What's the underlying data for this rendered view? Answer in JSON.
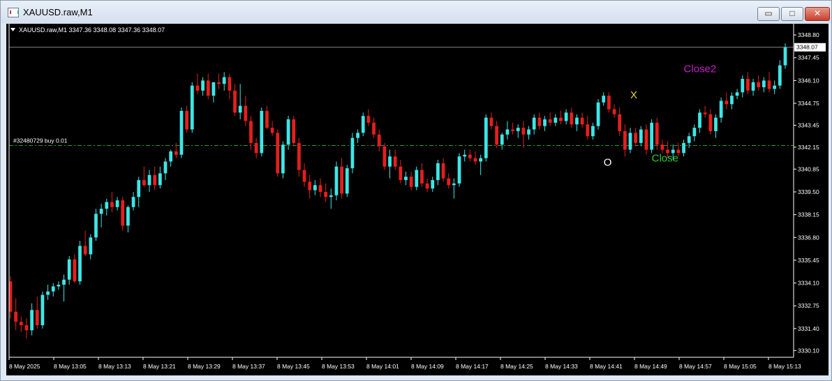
{
  "window": {
    "title": "XAUUSD.raw,M1",
    "buttons": {
      "minimize": "▭",
      "restore": "□",
      "close": "✕"
    }
  },
  "colors": {
    "bull": "#3ee6e6",
    "bear": "#e61e1e",
    "background": "#000000",
    "foreground": "#ffffff",
    "order_line": "#28a028"
  },
  "chart_data": {
    "type": "candlestick",
    "symbol_header": "XAUUSD.raw,M1  3347.36 3348.08 3347.36 3348.07",
    "ylim": [
      3329.7,
      3349.3
    ],
    "y_ticks": [
      "3348.80",
      "3347.45",
      "3346.10",
      "3344.75",
      "3343.45",
      "3342.15",
      "3340.85",
      "3339.50",
      "3338.15",
      "3336.80",
      "3335.45",
      "3334.10",
      "3332.75",
      "3331.40",
      "3330.10"
    ],
    "x_ticks": [
      "8 May 2025",
      "8 May 13:05",
      "8 May 13:13",
      "8 May 13:21",
      "8 May 13:29",
      "8 May 13:37",
      "8 May 13:45",
      "8 May 13:53",
      "8 May 14:01",
      "8 May 14:09",
      "8 May 14:17",
      "8 May 14:25",
      "8 May 14:33",
      "8 May 14:41",
      "8 May 14:49",
      "8 May 14:57",
      "8 May 15:05",
      "8 May 15:13"
    ],
    "current_price": "3348.07",
    "order_line": {
      "label": "#32480729 buy 0.01",
      "price": 3342.25
    },
    "annotations": [
      {
        "text": "O",
        "bar": 111,
        "price": 3341.05,
        "color": "#ffffff"
      },
      {
        "text": "X",
        "bar": 116,
        "price": 3345.05,
        "color": "#e6d23c"
      },
      {
        "text": "Close",
        "bar": 120,
        "price": 3341.3,
        "color": "#32c832"
      },
      {
        "text": "Close2",
        "bar": 126,
        "price": "3346.6",
        "color": "#c81ec8"
      }
    ],
    "candles": [
      [
        3334.2,
        3334.5,
        3332.0,
        3332.4
      ],
      [
        3332.4,
        3333.2,
        3331.3,
        3331.8
      ],
      [
        3331.8,
        3332.1,
        3331.2,
        3331.6
      ],
      [
        3331.6,
        3332.0,
        3330.8,
        3331.3
      ],
      [
        3331.3,
        3332.9,
        3331.0,
        3332.5
      ],
      [
        3332.5,
        3333.3,
        3331.4,
        3331.6
      ],
      [
        3331.6,
        3333.6,
        3331.4,
        3333.4
      ],
      [
        3333.4,
        3334.0,
        3333.1,
        3333.6
      ],
      [
        3333.6,
        3334.1,
        3333.3,
        3333.9
      ],
      [
        3333.9,
        3334.2,
        3333.7,
        3334.0
      ],
      [
        3334.0,
        3334.6,
        3333.0,
        3334.3
      ],
      [
        3334.3,
        3335.7,
        3334.0,
        3335.5
      ],
      [
        3335.5,
        3335.8,
        3334.1,
        3334.2
      ],
      [
        3334.2,
        3336.6,
        3334.0,
        3336.3
      ],
      [
        3336.3,
        3337.2,
        3335.7,
        3335.8
      ],
      [
        3335.8,
        3337.0,
        3335.5,
        3336.8
      ],
      [
        3336.8,
        3338.5,
        3336.6,
        3338.2
      ],
      [
        3338.2,
        3338.8,
        3337.4,
        3338.5
      ],
      [
        3338.5,
        3339.1,
        3338.1,
        3338.9
      ],
      [
        3338.9,
        3339.5,
        3338.3,
        3338.6
      ],
      [
        3338.6,
        3339.2,
        3338.4,
        3339.0
      ],
      [
        3339.0,
        3339.2,
        3337.2,
        3337.5
      ],
      [
        3337.5,
        3338.7,
        3337.1,
        3338.6
      ],
      [
        3338.6,
        3339.5,
        3338.4,
        3339.2
      ],
      [
        3339.2,
        3340.4,
        3338.6,
        3340.2
      ],
      [
        3340.2,
        3341.0,
        3339.8,
        3339.9
      ],
      [
        3339.9,
        3340.8,
        3339.5,
        3340.5
      ],
      [
        3340.5,
        3341.0,
        3339.6,
        3339.9
      ],
      [
        3339.9,
        3341.0,
        3339.7,
        3340.6
      ],
      [
        3340.6,
        3341.5,
        3340.2,
        3341.3
      ],
      [
        3341.3,
        3342.0,
        3341.0,
        3341.9
      ],
      [
        3341.9,
        3342.4,
        3341.5,
        3341.7
      ],
      [
        3341.7,
        3344.5,
        3341.5,
        3344.3
      ],
      [
        3344.3,
        3344.6,
        3343.0,
        3343.2
      ],
      [
        3343.2,
        3346.0,
        3343.0,
        3345.8
      ],
      [
        3345.8,
        3346.5,
        3345.3,
        3345.5
      ],
      [
        3345.5,
        3346.3,
        3345.2,
        3346.1
      ],
      [
        3346.1,
        3346.5,
        3345.0,
        3345.2
      ],
      [
        3345.2,
        3346.0,
        3344.8,
        3346.0
      ],
      [
        3346.0,
        3346.5,
        3345.6,
        3345.9
      ],
      [
        3345.9,
        3346.6,
        3345.5,
        3346.3
      ],
      [
        3346.3,
        3346.5,
        3345.0,
        3345.5
      ],
      [
        3345.5,
        3345.9,
        3344.0,
        3344.2
      ],
      [
        3344.2,
        3345.9,
        3343.8,
        3344.6
      ],
      [
        3344.6,
        3345.2,
        3343.4,
        3343.7
      ],
      [
        3343.7,
        3344.0,
        3342.0,
        3342.4
      ],
      [
        3342.4,
        3342.7,
        3341.5,
        3341.8
      ],
      [
        3341.8,
        3344.5,
        3341.6,
        3344.3
      ],
      [
        3344.3,
        3344.6,
        3343.2,
        3343.3
      ],
      [
        3343.3,
        3343.7,
        3342.8,
        3343.0
      ],
      [
        3343.0,
        3343.2,
        3340.4,
        3340.6
      ],
      [
        3340.6,
        3342.5,
        3340.3,
        3342.3
      ],
      [
        3342.3,
        3344.0,
        3342.0,
        3343.8
      ],
      [
        3343.8,
        3344.0,
        3342.2,
        3342.4
      ],
      [
        3342.4,
        3342.7,
        3340.4,
        3340.8
      ],
      [
        3340.8,
        3341.2,
        3339.8,
        3340.1
      ],
      [
        3340.1,
        3340.5,
        3339.1,
        3339.6
      ],
      [
        3339.6,
        3340.2,
        3339.3,
        3339.9
      ],
      [
        3339.9,
        3340.3,
        3339.2,
        3339.5
      ],
      [
        3339.5,
        3340.0,
        3338.9,
        3339.2
      ],
      [
        3339.2,
        3339.7,
        3338.5,
        3339.3
      ],
      [
        3339.3,
        3341.3,
        3339.0,
        3341.0
      ],
      [
        3341.0,
        3341.5,
        3339.1,
        3339.4
      ],
      [
        3339.4,
        3341.1,
        3339.2,
        3340.9
      ],
      [
        3340.9,
        3343.0,
        3340.6,
        3342.7
      ],
      [
        3342.7,
        3343.2,
        3342.4,
        3343.0
      ],
      [
        3343.0,
        3344.2,
        3342.8,
        3344.0
      ],
      [
        3344.0,
        3344.4,
        3343.4,
        3343.6
      ],
      [
        3343.6,
        3343.9,
        3342.7,
        3342.9
      ],
      [
        3342.9,
        3343.2,
        3341.9,
        3342.2
      ],
      [
        3342.2,
        3342.4,
        3340.8,
        3341.0
      ],
      [
        3341.0,
        3342.0,
        3340.3,
        3341.6
      ],
      [
        3341.6,
        3342.0,
        3340.8,
        3341.0
      ],
      [
        3341.0,
        3341.4,
        3340.0,
        3340.2
      ],
      [
        3340.2,
        3340.7,
        3339.9,
        3340.4
      ],
      [
        3340.4,
        3340.7,
        3339.6,
        3339.8
      ],
      [
        3339.8,
        3341.0,
        3339.6,
        3340.8
      ],
      [
        3340.8,
        3341.2,
        3339.8,
        3340.0
      ],
      [
        3340.0,
        3340.3,
        3339.5,
        3339.7
      ],
      [
        3339.7,
        3340.4,
        3339.5,
        3340.2
      ],
      [
        3340.2,
        3341.4,
        3339.9,
        3341.2
      ],
      [
        3341.2,
        3341.5,
        3340.1,
        3340.3
      ],
      [
        3340.3,
        3340.6,
        3339.7,
        3339.9
      ],
      [
        3339.9,
        3340.3,
        3339.1,
        3340.0
      ],
      [
        3340.0,
        3341.8,
        3339.8,
        3341.6
      ],
      [
        3341.6,
        3342.0,
        3341.3,
        3341.7
      ],
      [
        3341.7,
        3342.0,
        3341.3,
        3341.5
      ],
      [
        3341.5,
        3341.9,
        3341.1,
        3341.3
      ],
      [
        3341.3,
        3341.7,
        3340.5,
        3341.5
      ],
      [
        3341.5,
        3344.1,
        3341.3,
        3343.9
      ],
      [
        3343.9,
        3344.2,
        3343.2,
        3343.4
      ],
      [
        3343.4,
        3343.7,
        3342.1,
        3342.3
      ],
      [
        3342.3,
        3343.0,
        3342.0,
        3342.9
      ],
      [
        3342.9,
        3343.7,
        3342.6,
        3343.2
      ],
      [
        3343.2,
        3343.6,
        3342.9,
        3343.1
      ],
      [
        3343.1,
        3343.5,
        3342.7,
        3343.3
      ],
      [
        3343.3,
        3343.7,
        3342.1,
        3342.9
      ],
      [
        3342.9,
        3343.4,
        3342.6,
        3343.2
      ],
      [
        3343.2,
        3344.1,
        3342.9,
        3343.9
      ],
      [
        3343.9,
        3344.2,
        3343.2,
        3343.4
      ],
      [
        3343.4,
        3344.0,
        3343.1,
        3343.8
      ],
      [
        3343.8,
        3344.2,
        3343.4,
        3343.6
      ],
      [
        3343.6,
        3344.1,
        3343.4,
        3343.9
      ],
      [
        3343.9,
        3344.3,
        3343.5,
        3343.7
      ],
      [
        3343.7,
        3344.4,
        3343.5,
        3344.2
      ],
      [
        3344.2,
        3344.5,
        3343.3,
        3343.5
      ],
      [
        3343.5,
        3344.1,
        3343.1,
        3343.9
      ],
      [
        3343.9,
        3344.2,
        3343.3,
        3343.5
      ],
      [
        3343.5,
        3344.0,
        3342.6,
        3342.8
      ],
      [
        3342.8,
        3343.6,
        3342.6,
        3343.4
      ],
      [
        3343.4,
        3345.0,
        3343.2,
        3344.8
      ],
      [
        3344.8,
        3345.4,
        3344.6,
        3345.2
      ],
      [
        3345.2,
        3345.4,
        3344.2,
        3344.4
      ],
      [
        3344.4,
        3344.7,
        3343.9,
        3344.1
      ],
      [
        3344.1,
        3344.5,
        3342.8,
        3343.1
      ],
      [
        3343.1,
        3343.5,
        3341.6,
        3342.0
      ],
      [
        3342.0,
        3343.3,
        3341.8,
        3343.0
      ],
      [
        3343.0,
        3343.3,
        3342.2,
        3342.4
      ],
      [
        3342.4,
        3343.4,
        3342.2,
        3343.2
      ],
      [
        3343.2,
        3343.5,
        3341.7,
        3342.0
      ],
      [
        3342.0,
        3343.8,
        3341.8,
        3343.6
      ],
      [
        3343.6,
        3343.9,
        3342.0,
        3342.3
      ],
      [
        3342.3,
        3342.6,
        3341.8,
        3342.0
      ],
      [
        3342.0,
        3342.5,
        3341.5,
        3341.8
      ],
      [
        3341.8,
        3342.3,
        3341.4,
        3342.0
      ],
      [
        3342.0,
        3342.4,
        3341.6,
        3341.8
      ],
      [
        3341.8,
        3342.6,
        3341.6,
        3342.4
      ],
      [
        3342.4,
        3343.0,
        3342.1,
        3342.8
      ],
      [
        3342.8,
        3343.5,
        3342.5,
        3343.3
      ],
      [
        3343.3,
        3344.4,
        3343.0,
        3344.2
      ],
      [
        3344.2,
        3344.6,
        3343.9,
        3344.1
      ],
      [
        3344.1,
        3344.4,
        3342.9,
        3343.1
      ],
      [
        3343.1,
        3344.1,
        3342.7,
        3343.9
      ],
      [
        3343.9,
        3345.1,
        3343.6,
        3344.9
      ],
      [
        3344.9,
        3345.4,
        3344.4,
        3344.7
      ],
      [
        3344.7,
        3345.4,
        3344.4,
        3345.2
      ],
      [
        3345.2,
        3345.6,
        3345.0,
        3345.4
      ],
      [
        3345.4,
        3346.4,
        3345.1,
        3346.2
      ],
      [
        3346.2,
        3346.6,
        3345.3,
        3345.5
      ],
      [
        3345.5,
        3346.2,
        3345.2,
        3346.0
      ],
      [
        3346.0,
        3346.4,
        3345.5,
        3345.7
      ],
      [
        3345.7,
        3346.3,
        3345.4,
        3346.1
      ],
      [
        3346.1,
        3346.6,
        3345.4,
        3345.6
      ],
      [
        3345.6,
        3346.1,
        3345.3,
        3345.8
      ],
      [
        3345.8,
        3347.3,
        3345.6,
        3347.0
      ],
      [
        3347.0,
        3348.3,
        3346.8,
        3348.07
      ]
    ]
  }
}
